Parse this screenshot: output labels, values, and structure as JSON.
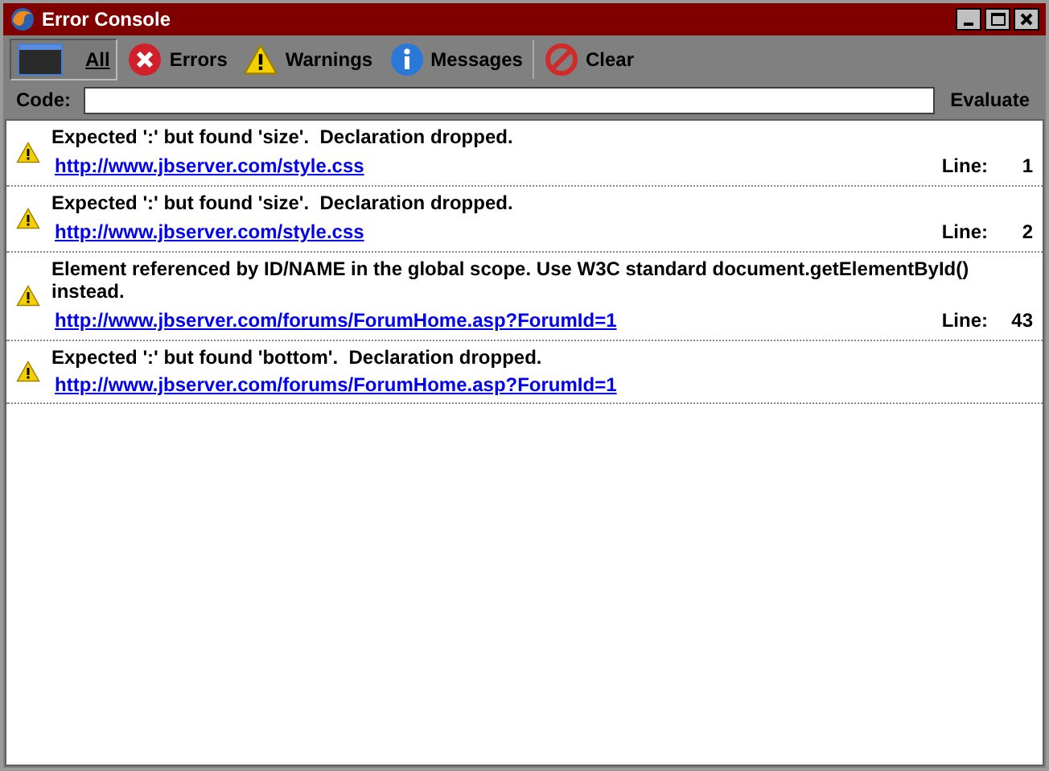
{
  "window": {
    "title": "Error Console"
  },
  "toolbar": [
    {
      "kind": "all",
      "label": "All",
      "selected": true
    },
    {
      "kind": "error",
      "label": "Errors",
      "selected": false
    },
    {
      "kind": "warning",
      "label": "Warnings",
      "selected": false
    },
    {
      "kind": "message",
      "label": "Messages",
      "selected": false
    },
    {
      "kind": "clear",
      "label": "Clear",
      "selected": false
    }
  ],
  "code_bar": {
    "label": "Code:",
    "button": "Evaluate"
  },
  "messages": [
    {
      "kind": "warning",
      "text": "Expected ':' but found 'size'.  Declaration dropped.",
      "url": "http://www.jbserver.com/style.css",
      "line_label": "Line:",
      "line": "1"
    },
    {
      "kind": "warning",
      "text": "Expected ':' but found 'size'.  Declaration dropped.",
      "url": "http://www.jbserver.com/style.css",
      "line_label": "Line:",
      "line": "2"
    },
    {
      "kind": "warning",
      "text": "Element referenced by ID/NAME in the global scope. Use W3C standard document.getElementById() instead.",
      "url": "http://www.jbserver.com/forums/ForumHome.asp?ForumId=1",
      "line_label": "Line:",
      "line": "43"
    },
    {
      "kind": "warning",
      "text": "Expected ':' but found 'bottom'.  Declaration dropped.",
      "url": "http://www.jbserver.com/forums/ForumHome.asp?ForumId=1"
    }
  ]
}
